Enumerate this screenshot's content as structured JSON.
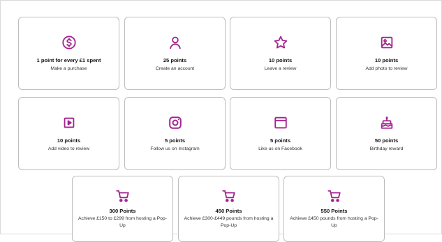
{
  "colors": {
    "accent": "#a3238f",
    "border": "#bdbdbd"
  },
  "cards": [
    {
      "icon": "dollar-circle-icon",
      "title": "1 point for every £1 spent",
      "subtitle": "Make a purchase"
    },
    {
      "icon": "user-icon",
      "title": "25 points",
      "subtitle": "Create an account"
    },
    {
      "icon": "star-icon",
      "title": "10 points",
      "subtitle": "Leave a review"
    },
    {
      "icon": "image-icon",
      "title": "10 points",
      "subtitle": "Add photo to review"
    },
    {
      "icon": "video-play-icon",
      "title": "10 points",
      "subtitle": "Add video to review"
    },
    {
      "icon": "instagram-icon",
      "title": "5 points",
      "subtitle": "Follow us on Instagram"
    },
    {
      "icon": "browser-window-icon",
      "title": "5 points",
      "subtitle": "Like us on Facebook"
    },
    {
      "icon": "birthday-cake-icon",
      "title": "50 points",
      "subtitle": "Birthday reward"
    },
    {
      "icon": "cart-icon",
      "title": "300 Points",
      "subtitle": "Achieve £150 to £299 from hosting a Pop-Up"
    },
    {
      "icon": "cart-icon",
      "title": "450 Points",
      "subtitle": "Achieve £300-£449 pounds from hosting a Pop-Up"
    },
    {
      "icon": "cart-icon",
      "title": "550 Points",
      "subtitle": "Achieve £450 pounds from hosting a Pop-Up"
    }
  ]
}
